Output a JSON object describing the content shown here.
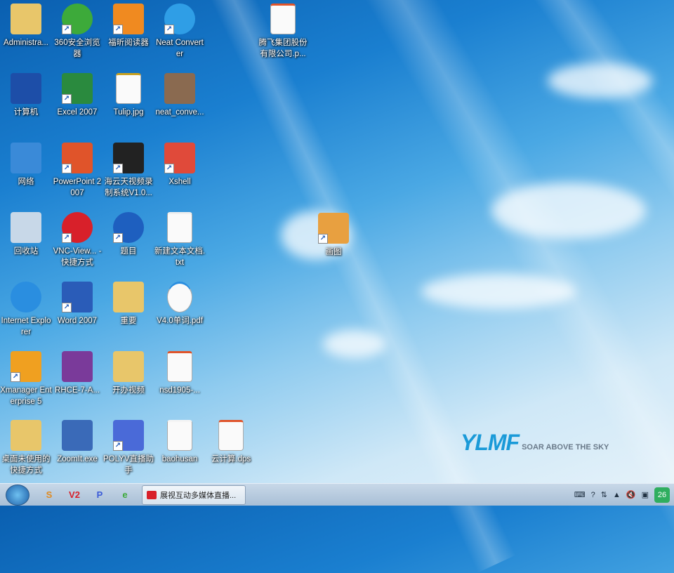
{
  "desktop": {
    "icons": [
      {
        "label": "Administra...",
        "icon": "user-folder-icon",
        "shortcut": false,
        "color": "#e8c66a"
      },
      {
        "label": "360安全浏览器",
        "icon": "360-browser-icon",
        "shortcut": true,
        "color": "#3daa3a"
      },
      {
        "label": "福昕阅读器",
        "icon": "foxit-reader-icon",
        "shortcut": true,
        "color": "#f08a20"
      },
      {
        "label": "Neat Converter",
        "icon": "neat-converter-icon",
        "shortcut": true,
        "color": "#2f9ee6"
      },
      {
        "label": "计算机",
        "icon": "computer-icon",
        "shortcut": false,
        "color": "#1d4ea8"
      },
      {
        "label": "Excel 2007",
        "icon": "excel-icon",
        "shortcut": true,
        "color": "#2a8a3e"
      },
      {
        "label": "Tulip.jpg",
        "icon": "image-file-icon",
        "shortcut": false,
        "color": "#c8a020"
      },
      {
        "label": "neat_conve...",
        "icon": "package-icon",
        "shortcut": false,
        "color": "#8a6a50"
      },
      {
        "label": "网络",
        "icon": "network-icon",
        "shortcut": false,
        "color": "#3a8ad8"
      },
      {
        "label": "PowerPoint 2007",
        "icon": "powerpoint-icon",
        "shortcut": true,
        "color": "#e0542a"
      },
      {
        "label": "海云天视频录制系统V1.0...",
        "icon": "camera-icon",
        "shortcut": true,
        "color": "#222222"
      },
      {
        "label": "Xshell",
        "icon": "xshell-icon",
        "shortcut": true,
        "color": "#e04a3a"
      },
      {
        "label": "回收站",
        "icon": "recycle-bin-icon",
        "shortcut": false,
        "color": "#c8d8e8"
      },
      {
        "label": "VNC-View... - 快捷方式",
        "icon": "vnc-viewer-icon",
        "shortcut": true,
        "color": "#d8202a"
      },
      {
        "label": "题目",
        "icon": "wave-app-icon",
        "shortcut": true,
        "color": "#1e5fbf"
      },
      {
        "label": "新建文本文档.txt",
        "icon": "text-file-icon",
        "shortcut": false,
        "color": "#f0f0f0"
      },
      {
        "label": "Internet Explorer",
        "icon": "ie-icon",
        "shortcut": false,
        "color": "#2a8ee0"
      },
      {
        "label": "Word 2007",
        "icon": "word-icon",
        "shortcut": true,
        "color": "#2a5cb8"
      },
      {
        "label": "重要",
        "icon": "folder-icon",
        "shortcut": false,
        "color": "#e8c66a"
      },
      {
        "label": "V4.0单词.pdf",
        "icon": "pdf-ie-file-icon",
        "shortcut": false,
        "color": "#2a8ee0"
      },
      {
        "label": "Xmanager Enterprise 5",
        "icon": "xmanager-icon",
        "shortcut": true,
        "color": "#f0a020"
      },
      {
        "label": "RHCE-7-A...",
        "icon": "winrar-icon",
        "shortcut": false,
        "color": "#7a3a9a"
      },
      {
        "label": "开办视频",
        "icon": "folder-icon",
        "shortcut": false,
        "color": "#e8c66a"
      },
      {
        "label": "nsd1905-...",
        "icon": "presentation-file-icon",
        "shortcut": false,
        "color": "#e0542a"
      },
      {
        "label": "桌面未使用的快捷方式",
        "icon": "shortcut-folder-icon",
        "shortcut": false,
        "color": "#e8c66a"
      },
      {
        "label": "ZoomIt.exe",
        "icon": "zoomit-icon",
        "shortcut": false,
        "color": "#3a6ab8"
      },
      {
        "label": "POLYV直播助手",
        "icon": "polyv-icon",
        "shortcut": true,
        "color": "#4a6ad8"
      },
      {
        "label": "baohusan",
        "icon": "blank-file-icon",
        "shortcut": false,
        "color": "#f4f4f4"
      },
      {
        "label": "云计算.dps",
        "icon": "dps-file-icon",
        "shortcut": false,
        "color": "#e0542a"
      },
      {
        "label": "腾飞集团股份有限公司.p...",
        "icon": "presentation-file-icon",
        "shortcut": false,
        "color": "#e0542a"
      },
      {
        "label": "画图",
        "icon": "paint-icon",
        "shortcut": true,
        "color": "#e8a040"
      }
    ]
  },
  "logo": {
    "text": "YLMF",
    "tagline": "SOAR ABOVE THE SKY"
  },
  "taskbar": {
    "pinned": [
      {
        "icon": "360-icon",
        "label": "S"
      },
      {
        "icon": "vnc-icon",
        "label": "V2"
      },
      {
        "icon": "polyv-icon",
        "label": "P"
      },
      {
        "icon": "360-browser-icon",
        "label": "e"
      }
    ],
    "active_task": "展视互动多媒体直播...",
    "tray": {
      "icons": [
        "keyboard-icon",
        "help-icon",
        "network-icon",
        "show-hidden-icon",
        "volume-muted-icon",
        "action-center-icon"
      ],
      "clock": "26"
    }
  }
}
